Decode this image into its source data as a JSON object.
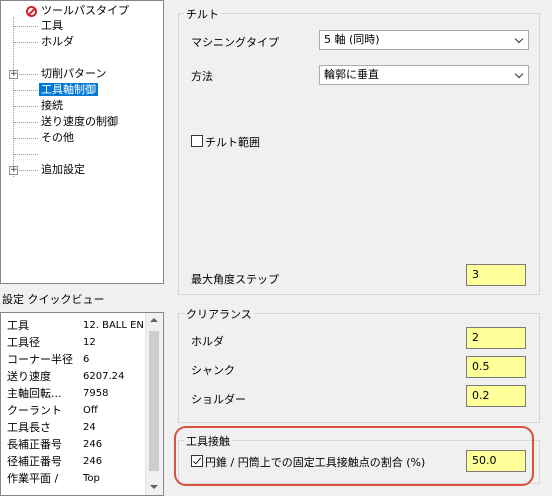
{
  "tree": {
    "items": [
      {
        "label": "ツールパスタイプ"
      },
      {
        "label": "工具"
      },
      {
        "label": "ホルダ"
      },
      {
        "label": "切削パターン"
      },
      {
        "label": "工具軸制御"
      },
      {
        "label": "接続"
      },
      {
        "label": "送り速度の制御"
      },
      {
        "label": "その他"
      },
      {
        "label": "追加設定"
      }
    ]
  },
  "quickview": {
    "title": "設定 クイックビュー",
    "rows": [
      {
        "key": "工具",
        "value": "12. BALL EN"
      },
      {
        "key": "工具径",
        "value": "12"
      },
      {
        "key": "コーナー半径",
        "value": "6"
      },
      {
        "key": "送り速度",
        "value": "6207.24"
      },
      {
        "key": "主軸回転...",
        "value": "7958"
      },
      {
        "key": "クーラント",
        "value": "Off"
      },
      {
        "key": "工具長さ",
        "value": "24"
      },
      {
        "key": "長補正番号",
        "value": "246"
      },
      {
        "key": "径補正番号",
        "value": "246"
      },
      {
        "key": "作業平面 /",
        "value": "Top"
      }
    ]
  },
  "tilt": {
    "title": "チルト",
    "machining_type_label": "マシニングタイプ",
    "machining_type_value": "5 軸 (同時)",
    "method_label": "方法",
    "method_value": "輪郭に垂直",
    "tilt_range_label": "チルト範囲",
    "max_angle_step_label": "最大角度ステップ",
    "max_angle_step_value": "3"
  },
  "clearance": {
    "title": "クリアランス",
    "holder_label": "ホルダ",
    "holder_value": "2",
    "shank_label": "シャンク",
    "shank_value": "0.5",
    "shoulder_label": "ショルダー",
    "shoulder_value": "0.2"
  },
  "tool_contact": {
    "title": "工具接触",
    "checkbox_label": "円錐 / 円筒上での固定工具接触点の割合 (%)",
    "value": "50.0",
    "checked": true
  },
  "colors": {
    "selection": "#0078d7",
    "field_yellow": "#ffff99",
    "highlight": "#d9503d",
    "prohibit": "#d0202a"
  }
}
